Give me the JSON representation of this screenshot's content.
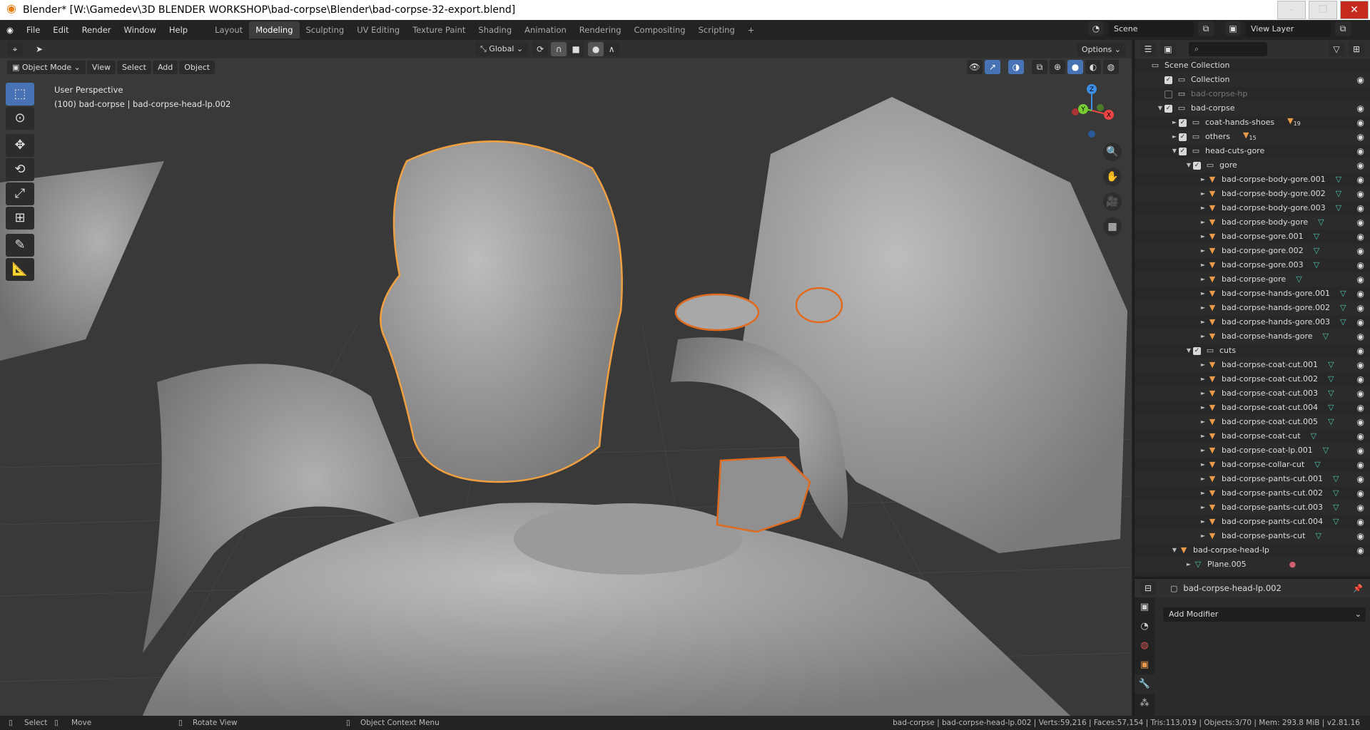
{
  "window": {
    "title": "Blender* [W:\\Gamedev\\3D BLENDER WORKSHOP\\bad-corpse\\Blender\\bad-corpse-32-export.blend]"
  },
  "menu": [
    "File",
    "Edit",
    "Render",
    "Window",
    "Help"
  ],
  "workspaces": [
    "Layout",
    "Modeling",
    "Sculpting",
    "UV Editing",
    "Texture Paint",
    "Shading",
    "Animation",
    "Rendering",
    "Compositing",
    "Scripting",
    "+"
  ],
  "active_workspace": "Modeling",
  "scene": "Scene",
  "view_layer": "View Layer",
  "viewport": {
    "orientation": "Global",
    "options": "Options",
    "mode": "Object Mode",
    "menus": [
      "View",
      "Select",
      "Add",
      "Object"
    ],
    "info_line1": "User Perspective",
    "info_line2": "(100) bad-corpse | bad-corpse-head-lp.002",
    "axes": {
      "x": "X",
      "y": "Y",
      "z": "Z"
    }
  },
  "outliner": {
    "rows": [
      {
        "label": "Scene Collection",
        "level": 0,
        "type": "coll",
        "arrow": "",
        "check": null,
        "eye": false
      },
      {
        "label": "Collection",
        "level": 1,
        "type": "coll",
        "arrow": "",
        "check": true,
        "eye": true
      },
      {
        "label": "bad-corpse-hp",
        "level": 1,
        "type": "coll",
        "arrow": "",
        "check": false,
        "eye": false,
        "dim": true
      },
      {
        "label": "bad-corpse",
        "level": 1,
        "type": "coll",
        "arrow": "▼",
        "check": true,
        "eye": true
      },
      {
        "label": "coat-hands-shoes",
        "level": 2,
        "type": "coll",
        "arrow": "►",
        "check": true,
        "eye": true,
        "badge": "19"
      },
      {
        "label": "others",
        "level": 2,
        "type": "coll",
        "arrow": "►",
        "check": true,
        "eye": true,
        "badge": "15"
      },
      {
        "label": "head-cuts-gore",
        "level": 2,
        "type": "coll",
        "arrow": "▼",
        "check": true,
        "eye": true
      },
      {
        "label": "gore",
        "level": 3,
        "type": "coll",
        "arrow": "▼",
        "check": true,
        "eye": true
      },
      {
        "label": "bad-corpse-body-gore.001",
        "level": 4,
        "type": "obj",
        "arrow": "►",
        "eye": true,
        "mod": true
      },
      {
        "label": "bad-corpse-body-gore.002",
        "level": 4,
        "type": "obj",
        "arrow": "►",
        "eye": true,
        "mod": true
      },
      {
        "label": "bad-corpse-body-gore.003",
        "level": 4,
        "type": "obj",
        "arrow": "►",
        "eye": true,
        "mod": true
      },
      {
        "label": "bad-corpse-body-gore",
        "level": 4,
        "type": "obj",
        "arrow": "►",
        "eye": true,
        "mod": true
      },
      {
        "label": "bad-corpse-gore.001",
        "level": 4,
        "type": "obj",
        "arrow": "►",
        "eye": true,
        "mod": true
      },
      {
        "label": "bad-corpse-gore.002",
        "level": 4,
        "type": "obj",
        "arrow": "►",
        "eye": true,
        "mod": true
      },
      {
        "label": "bad-corpse-gore.003",
        "level": 4,
        "type": "obj",
        "arrow": "►",
        "eye": true,
        "mod": true
      },
      {
        "label": "bad-corpse-gore",
        "level": 4,
        "type": "obj",
        "arrow": "►",
        "eye": true,
        "mod": true
      },
      {
        "label": "bad-corpse-hands-gore.001",
        "level": 4,
        "type": "obj",
        "arrow": "►",
        "eye": true,
        "mod": true
      },
      {
        "label": "bad-corpse-hands-gore.002",
        "level": 4,
        "type": "obj",
        "arrow": "►",
        "eye": true,
        "mod": true
      },
      {
        "label": "bad-corpse-hands-gore.003",
        "level": 4,
        "type": "obj",
        "arrow": "►",
        "eye": true,
        "mod": true
      },
      {
        "label": "bad-corpse-hands-gore",
        "level": 4,
        "type": "obj",
        "arrow": "►",
        "eye": true,
        "mod": true
      },
      {
        "label": "cuts",
        "level": 3,
        "type": "coll",
        "arrow": "▼",
        "check": true,
        "eye": true
      },
      {
        "label": "bad-corpse-coat-cut.001",
        "level": 4,
        "type": "obj",
        "arrow": "►",
        "eye": true,
        "mod": true
      },
      {
        "label": "bad-corpse-coat-cut.002",
        "level": 4,
        "type": "obj",
        "arrow": "►",
        "eye": true,
        "mod": true
      },
      {
        "label": "bad-corpse-coat-cut.003",
        "level": 4,
        "type": "obj",
        "arrow": "►",
        "eye": true,
        "mod": true
      },
      {
        "label": "bad-corpse-coat-cut.004",
        "level": 4,
        "type": "obj",
        "arrow": "►",
        "eye": true,
        "mod": true
      },
      {
        "label": "bad-corpse-coat-cut.005",
        "level": 4,
        "type": "obj",
        "arrow": "►",
        "eye": true,
        "mod": true
      },
      {
        "label": "bad-corpse-coat-cut",
        "level": 4,
        "type": "obj",
        "arrow": "►",
        "eye": true,
        "mod": true
      },
      {
        "label": "bad-corpse-coat-lp.001",
        "level": 4,
        "type": "obj",
        "arrow": "►",
        "eye": true,
        "mod": true
      },
      {
        "label": "bad-corpse-collar-cut",
        "level": 4,
        "type": "obj",
        "arrow": "►",
        "eye": true,
        "mod": true
      },
      {
        "label": "bad-corpse-pants-cut.001",
        "level": 4,
        "type": "obj",
        "arrow": "►",
        "eye": true,
        "mod": true
      },
      {
        "label": "bad-corpse-pants-cut.002",
        "level": 4,
        "type": "obj",
        "arrow": "►",
        "eye": true,
        "mod": true
      },
      {
        "label": "bad-corpse-pants-cut.003",
        "level": 4,
        "type": "obj",
        "arrow": "►",
        "eye": true,
        "mod": true
      },
      {
        "label": "bad-corpse-pants-cut.004",
        "level": 4,
        "type": "obj",
        "arrow": "►",
        "eye": true,
        "mod": true
      },
      {
        "label": "bad-corpse-pants-cut",
        "level": 4,
        "type": "obj",
        "arrow": "►",
        "eye": true,
        "mod": true
      },
      {
        "label": "bad-corpse-head-lp",
        "level": 2,
        "type": "obj",
        "arrow": "▼",
        "eye": true
      },
      {
        "label": "Plane.005",
        "level": 3,
        "type": "mesh",
        "arrow": "►",
        "eye": false
      }
    ]
  },
  "properties": {
    "object_name": "bad-corpse-head-lp.002",
    "add_modifier": "Add Modifier"
  },
  "statusbar": {
    "select": "Select",
    "move": "Move",
    "rotate": "Rotate View",
    "context": "Object Context Menu",
    "stats": "bad-corpse | bad-corpse-head-lp.002 | Verts:59,216 | Faces:57,154 | Tris:113,019 | Objects:3/70 | Mem: 293.8 MiB | v2.81.16"
  },
  "colors": {
    "accent": "#4772b3",
    "selection": "#e8994a",
    "active_outline": "#e06a1e"
  }
}
